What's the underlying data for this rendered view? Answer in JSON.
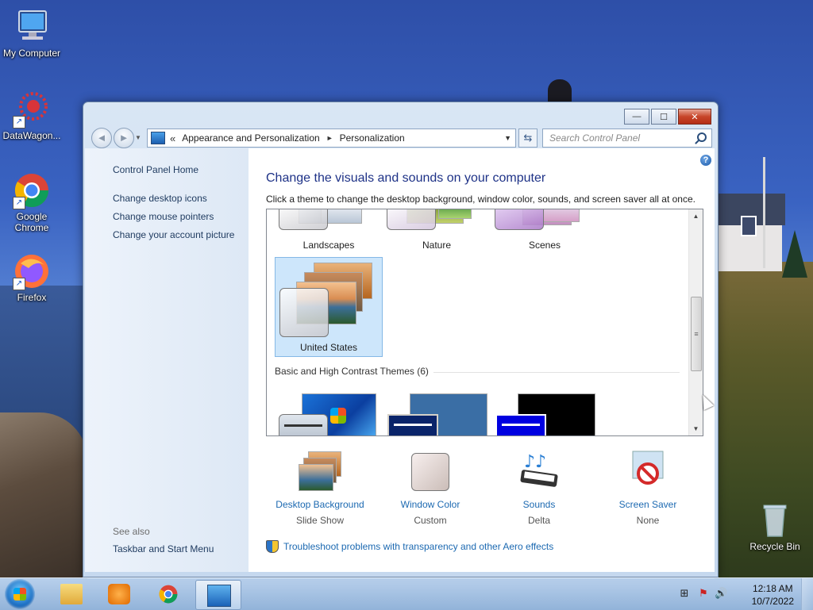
{
  "desktop": {
    "icons": [
      {
        "label": "My Computer"
      },
      {
        "label": "DataWagon..."
      },
      {
        "label": "Google Chrome"
      },
      {
        "label": "Firefox"
      },
      {
        "label": "Recycle Bin"
      }
    ]
  },
  "window": {
    "caption_buttons": {
      "minimize": "—",
      "maximize": "☐",
      "close": "✕"
    },
    "address": {
      "overflow": "«",
      "crumbs": [
        "Appearance and Personalization",
        "Personalization"
      ],
      "separator": "►"
    },
    "search": {
      "placeholder": "Search Control Panel"
    },
    "left_pane": {
      "home": "Control Panel Home",
      "links": [
        "Change desktop icons",
        "Change mouse pointers",
        "Change your account picture"
      ],
      "see_also": "See also",
      "see_also_links": [
        "Taskbar and Start Menu"
      ]
    },
    "content": {
      "heading": "Change the visuals and sounds on your computer",
      "subheading": "Click a theme to change the desktop background, window color, sounds, and screen saver all at once.",
      "themes": [
        {
          "name": "Landscapes"
        },
        {
          "name": "Nature"
        },
        {
          "name": "Scenes"
        },
        {
          "name": "United States",
          "selected": true
        }
      ],
      "basic_group_label": "Basic and High Contrast Themes (6)",
      "settings": [
        {
          "label": "Desktop Background",
          "value": "Slide Show",
          "icon": "desktop-background-icon"
        },
        {
          "label": "Window Color",
          "value": "Custom",
          "icon": "window-color-icon"
        },
        {
          "label": "Sounds",
          "value": "Delta",
          "icon": "sounds-icon"
        },
        {
          "label": "Screen Saver",
          "value": "None",
          "icon": "screen-saver-icon"
        }
      ],
      "troubleshoot_link": "Troubleshoot problems with transparency and other Aero effects"
    }
  },
  "taskbar": {
    "clock": {
      "time": "12:18 AM",
      "date": "10/7/2022"
    }
  }
}
